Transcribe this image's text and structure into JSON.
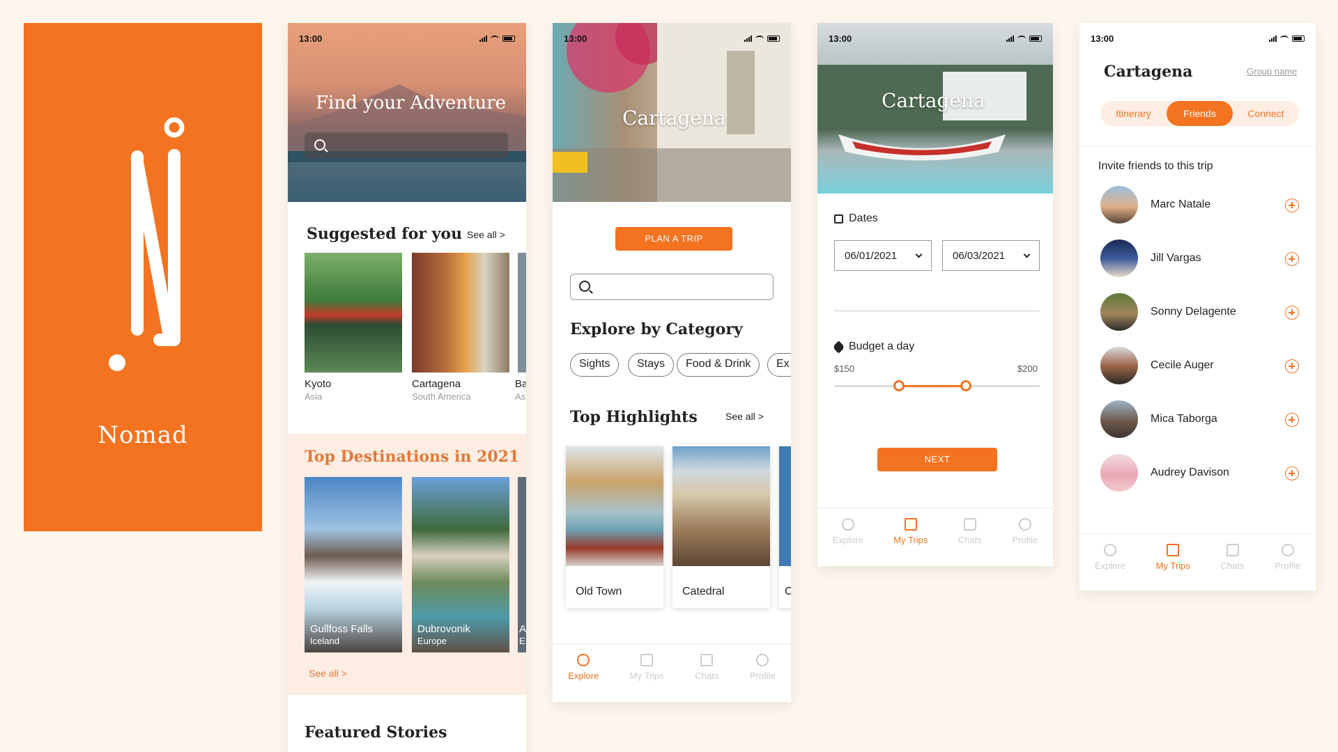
{
  "logo": {
    "brand": "Nomad",
    "letter": "N"
  },
  "status": {
    "time": "13:00"
  },
  "explore": {
    "hero_title": "Find your Adventure",
    "suggested_title": "Suggested for you",
    "see_all": "See all >",
    "suggested": [
      {
        "name": "Kyoto",
        "region": "Asia"
      },
      {
        "name": "Cartagena",
        "region": "South America"
      },
      {
        "name": "Ba",
        "region": "As"
      }
    ],
    "top_title": "Top Destinations in 2021",
    "top": [
      {
        "name": "Gullfoss Falls",
        "region": "Iceland"
      },
      {
        "name": "Dubrovonik",
        "region": "Europe"
      },
      {
        "name": "A",
        "region": "E"
      }
    ],
    "top_see_all": "See all >",
    "featured_title": "Featured Stories"
  },
  "city": {
    "hero_city": "Cartagena",
    "plan_button": "PLAN A TRIP",
    "explore_title": "Explore by Category",
    "chips": [
      "Sights",
      "Stays",
      "Food & Drink",
      "Ex"
    ],
    "highlights_title": "Top Highlights",
    "see_all": "See all >",
    "highlights": [
      "Old Town",
      "Catedral",
      "C"
    ]
  },
  "plan": {
    "hero_city": "Cartagena",
    "dates_label": "Dates",
    "date_from": "06/01/2021",
    "date_to": "06/03/2021",
    "budget_label": "Budget a day",
    "budget_min": "$150",
    "budget_max": "$200",
    "next_button": "NEXT"
  },
  "friends": {
    "title": "Cartagena",
    "group_name": "Group name",
    "tabs": [
      "Itinerary",
      "Friends",
      "Connect"
    ],
    "invite_title": "Invite friends to this trip",
    "people": [
      "Marc Natale",
      "Jill Vargas",
      "Sonny Delagente",
      "Cecile Auger",
      "Mica Taborga",
      "Audrey Davison"
    ]
  },
  "tabbar": [
    "Explore",
    "My Trips",
    "Chats",
    "Profile"
  ],
  "colors": {
    "accent": "#f37321",
    "background": "#fdf6ec",
    "soft": "#fdede3"
  }
}
